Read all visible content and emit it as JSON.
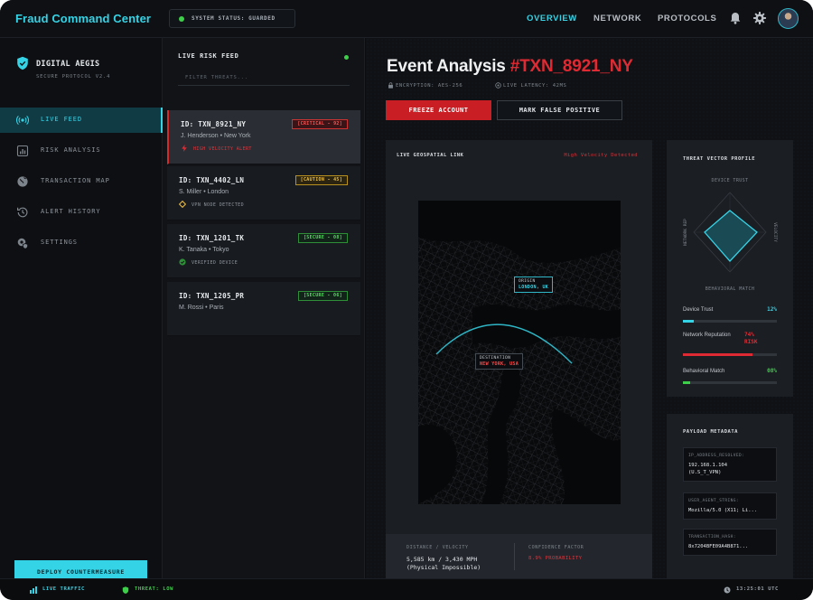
{
  "app": {
    "title": "Fraud Command Center",
    "system_status": "SYSTEM STATUS: GUARDED"
  },
  "top_nav": [
    {
      "label": "OVERVIEW",
      "active": true
    },
    {
      "label": "NETWORK",
      "active": false
    },
    {
      "label": "PROTOCOLS",
      "active": false
    }
  ],
  "top_icons": [
    "bell-icon",
    "gear-icon"
  ],
  "sidebar": {
    "brand": "DIGITAL AEGIS",
    "subtitle": "SECURE PROTOCOL V2.4",
    "items": [
      {
        "label": "LIVE FEED",
        "icon": "broadcast-icon",
        "active": true
      },
      {
        "label": "RISK ANALYSIS",
        "icon": "chart-icon",
        "active": false
      },
      {
        "label": "TRANSACTION MAP",
        "icon": "globe-icon",
        "active": false
      },
      {
        "label": "ALERT HISTORY",
        "icon": "history-icon",
        "active": false
      },
      {
        "label": "SETTINGS",
        "icon": "gear-shield-icon",
        "active": false
      }
    ],
    "deploy_label": "DEPLOY COUNTERMEASURE"
  },
  "feed": {
    "title": "LIVE RISK FEED",
    "filter_placeholder": "FILTER THREATS...",
    "items": [
      {
        "id": "ID: TXN_8921_NY",
        "who": "J. Henderson • New York",
        "badge": "[CRITICAL - 92]",
        "level": "critical",
        "note": "HIGH VELOCITY ALERT",
        "selected": true
      },
      {
        "id": "ID: TXN_4402_LN",
        "who": "S. Miller • London",
        "badge": "[CAUTION - 45]",
        "level": "caution",
        "note": "VPN NODE DETECTED",
        "selected": false
      },
      {
        "id": "ID: TXN_1201_TK",
        "who": "K. Tanaka • Tokyo",
        "badge": "[SECURE - 08]",
        "level": "secure",
        "note": "VERIFIED DEVICE",
        "selected": false
      },
      {
        "id": "ID: TXN_1205_PR",
        "who": "M. Rossi • Paris",
        "badge": "[SECURE - 06]",
        "level": "secure",
        "note": "",
        "selected": false
      }
    ]
  },
  "event": {
    "title_prefix": "Event Analysis ",
    "title_id": "#TXN_8921_NY",
    "encryption": "ENCRYPTION: AES-256",
    "latency": "LIVE LATENCY: 42MS",
    "freeze_label": "FREEZE ACCOUNT",
    "mark_label": "MARK FALSE POSITIVE"
  },
  "geo": {
    "title": "LIVE GEOSPATIAL LINK",
    "warning": "High Velocity Detected",
    "origin_label": "ORIGIN",
    "origin_city": "LONDON, UK",
    "dest_label": "DESTINATION",
    "dest_city": "NEW YORK, USA",
    "dist_label": "DISTANCE / VELOCITY",
    "dist_value_1": "5,585 km / 3,430 MPH",
    "dist_value_2": "(Physical Impossible)",
    "conf_label": "CONFIDENCE FACTOR",
    "conf_value": "8.9% PROBABILITY"
  },
  "threat_profile": {
    "title": "THREAT VECTOR PROFILE",
    "axis_top": "DEVICE TRUST",
    "axis_bottom": "BEHAVIORAL MATCH",
    "axis_left": "NETWORK REP",
    "axis_right": "VELOCITY",
    "metrics": [
      {
        "label": "Device Trust",
        "value": "12%",
        "fill": 0.12,
        "color": "#35d3e6"
      },
      {
        "label": "Network Reputation",
        "value_1": "74%",
        "value_2": "RISK",
        "fill": 0.74,
        "color": "#e02a33"
      },
      {
        "label": "Behavioral Match",
        "value": "08%",
        "fill": 0.08,
        "color": "#3ecf4a"
      }
    ]
  },
  "payload": {
    "title": "PAYLOAD METADATA",
    "entries": [
      {
        "key": "IP_ADDRESS_RESOLVED:",
        "value_1": "192.168.1.104",
        "value_2": "(U.S_T_VPN)"
      },
      {
        "key": "USER_AGENT_STRING:",
        "value_1": "Mozilla/5.0 (X11; Li..."
      },
      {
        "key": "TRANSACTION_HASH:",
        "value_1": "8x7204BFE09A4B871..."
      }
    ]
  },
  "status_bar": {
    "traffic": "LIVE TRAFFIC",
    "threat": "THREAT: LOW",
    "clock": "13:25:01 UTC"
  },
  "colors": {
    "accent": "#35d3e6",
    "danger": "#e02a33",
    "ok": "#3ecf4a",
    "caution": "#f0c040"
  }
}
